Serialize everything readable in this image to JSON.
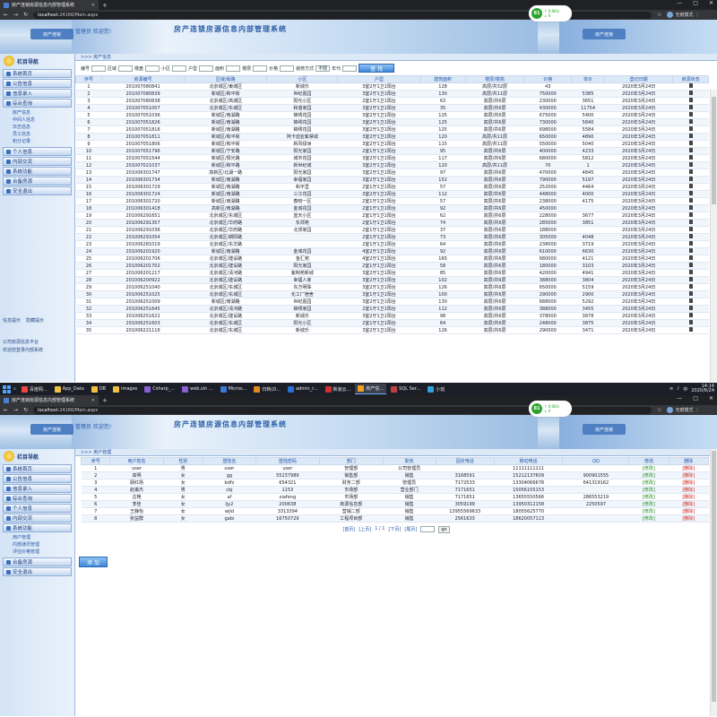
{
  "browser": {
    "tab_title": "房产连锁房源信息内部管理系统",
    "new_tab_symbol": "+",
    "url_host": "localhost",
    "url_path": ":24166/Main.aspx",
    "profile_name": "无痕模式",
    "win_min": "—",
    "win_max": "□",
    "win_close": "✕"
  },
  "netmon": {
    "percent": "81",
    "up": "↑ 0.6K/s",
    "down": "↓ 0"
  },
  "app": {
    "welcome": "管理员 欢迎您!",
    "title": "房产连锁房源信息内部管理系统",
    "logo_text": "房产连锁"
  },
  "sidebar": {
    "home_label": "栏目导航",
    "menus": [
      "系统首页",
      "公告信息",
      "信息录入",
      "综合查询",
      "个人信息",
      "内部交流",
      "系统功能",
      "合备房源",
      "安全退出"
    ],
    "sub_query": [
      "房产信息",
      "中间人信息",
      "日志信息",
      "员工信息",
      "积分记录"
    ],
    "sub_system": [
      "用户管理",
      "内部通讯管理",
      "评估价格管理"
    ],
    "footer_a": [
      "信息提示",
      "隐藏提示"
    ],
    "footer_b": [
      "公司房源信息平台",
      "欢迎您登录内部系统"
    ]
  },
  "screen_a": {
    "breadcrumb": ">>> 房产信息",
    "filters": [
      "编号",
      "区域",
      "楼盘",
      "小区",
      "户型",
      "面积",
      "楼层",
      "价格",
      "装修方式",
      "年代"
    ],
    "filter_select": "不限",
    "query_button": "查 找",
    "columns": [
      "序号",
      "房源编号",
      "区域/街路",
      "小区",
      "户型",
      "建筑面积",
      "楼层/楼高",
      "价格",
      "单价",
      "登记日期",
      "房源状态"
    ],
    "rows": [
      [
        "1",
        "201007080841",
        "北京城区/東城区",
        "新城乐",
        "3室2厅1卫1阳台",
        "128",
        "高层/共32层",
        "43",
        "",
        "2020年3月24日"
      ],
      [
        "2",
        "201007080839",
        "新城区/和平街",
        "世纪嘉园",
        "3室2厅1卫1阳台",
        "130",
        "高层/共11层",
        "750000",
        "5385",
        "2020年3月24日"
      ],
      [
        "3",
        "201007080838",
        "北京城区/高城区",
        "阳光小区",
        "2室1厅1卫1阳台",
        "63",
        "高层/共6层",
        "230000",
        "3651",
        "2020年3月24日"
      ],
      [
        "4",
        "201007051007",
        "北京城区/东城区",
        "和谐家园",
        "3室2厅1卫1阳台",
        "35",
        "高层/共6层",
        "430000",
        "11754",
        "2020年3月24日"
      ],
      [
        "5",
        "201007051036",
        "新城区/南湖路",
        "锦绣花园",
        "3室2厅1卫1阳台",
        "125",
        "高层/共6层",
        "675000",
        "5400",
        "2020年3月24日"
      ],
      [
        "6",
        "201007051826",
        "新城区/南湖路",
        "锦绣花园",
        "3室2厅1卫1阳台",
        "125",
        "高层/共6层",
        "730000",
        "5840",
        "2020年3月24日"
      ],
      [
        "7",
        "201007051816",
        "新城区/南湖路",
        "锦绣花园",
        "3室2厅1卫1阳台",
        "125",
        "高层/共6层",
        "698000",
        "5584",
        "2020年3月24日"
      ],
      [
        "8",
        "201007051811",
        "新城区/和平街",
        "阿卡迪亚紫禁城",
        "3室2厅1卫1阳台",
        "120",
        "高层/共11层",
        "650000",
        "4890",
        "2020年3月24日"
      ],
      [
        "9",
        "201007051806",
        "新城区/和平街",
        "新风绿洲",
        "3室2厅1卫1阳台",
        "115",
        "高层/共11层",
        "550000",
        "5040",
        "2020年3月24日"
      ],
      [
        "10",
        "201007051796",
        "新城区/宁安路",
        "阳光家园",
        "2室1厅1卫1阳台",
        "95",
        "高层/共6层",
        "400000",
        "4233",
        "2020年3月24日"
      ],
      [
        "11",
        "201007051544",
        "新城区/阳光路",
        "城市花园",
        "3室2厅1卫1阳台",
        "117",
        "高层/共6层",
        "680000",
        "5812",
        "2020年3月24日"
      ],
      [
        "12",
        "201007021037",
        "新城区/和平路",
        "新世纪城",
        "3室2厅1卫1阳台",
        "120",
        "高层/共11层",
        "70",
        "1",
        "2020年3月24日"
      ],
      [
        "13",
        "201006301747",
        "高新区/北湖一路",
        "阳光家园",
        "3室2厅1卫1阳台",
        "97",
        "高层/共6层",
        "470000",
        "4845",
        "2020年3月24日"
      ],
      [
        "14",
        "201006301734",
        "新城区/南湖路",
        "幸福家园",
        "3室2厅1卫1阳台",
        "152",
        "高层/共6层",
        "790000",
        "5197",
        "2020年3月24日"
      ],
      [
        "15",
        "201006301729",
        "新城区/南湖路",
        "和平里",
        "2室1厅1卫1阳台",
        "57",
        "高层/共6层",
        "252000",
        "4464",
        "2020年3月24日"
      ],
      [
        "16",
        "201006301724",
        "新城区/南湖路",
        "三江花园",
        "3室2厅1卫1阳台",
        "112",
        "高层/共6层",
        "448000",
        "4000",
        "2020年3月24日"
      ],
      [
        "17",
        "201006301720",
        "新城区/南湖路",
        "春晓一区",
        "2室1厅1卫1阳台",
        "57",
        "高层/共6层",
        "238000",
        "4175",
        "2020年3月24日"
      ],
      [
        "18",
        "201006301418",
        "高新区/南湖路",
        "金城花园",
        "2室1厅1卫1阳台",
        "92",
        "高层/共6层",
        "450000",
        "",
        "2020年3月24日"
      ],
      [
        "19",
        "201006291651",
        "北京城区/东城区",
        "蓝天小区",
        "2室1厅1卫1阳台",
        "62",
        "高层/共6层",
        "228000",
        "3677",
        "2020年3月24日"
      ],
      [
        "20",
        "201006291357",
        "北京城区/华府路",
        "东郊苑",
        "2室1厅1卫1阳台",
        "74",
        "高层/共6层",
        "285000",
        "3851",
        "2020年3月24日"
      ],
      [
        "21",
        "201006291036",
        "北京城区/华府路",
        "北郊家园",
        "2室1厅1卫1阳台",
        "37",
        "高层/共6层",
        "188000",
        "",
        "2020年3月24日"
      ],
      [
        "22",
        "201006291054",
        "北京城区/朝阳路",
        "",
        "2室1厅1卫1阳台",
        "73",
        "高层/共6层",
        "305000",
        "4048",
        "2020年3月24日"
      ],
      [
        "23",
        "201006281019",
        "北京城区/东华路",
        "",
        "2室1厅1卫1阳台",
        "64",
        "高层/共6层",
        "238000",
        "3719",
        "2020年3月24日"
      ],
      [
        "24",
        "201006201920",
        "新城区/南湖路",
        "金城花园",
        "4室2厅1卫1阳台",
        "92",
        "高层/共6层",
        "610000",
        "6630",
        "2020年3月24日"
      ],
      [
        "25",
        "201006201706",
        "北京城区/建设路",
        "金汇苑",
        "4室2厅1卫1阳台",
        "165",
        "高层/共6层",
        "680000",
        "4121",
        "2020年3月24日"
      ],
      [
        "26",
        "201006201702",
        "北京城区/建设路",
        "阳光家园",
        "2室1厅1卫1阳台",
        "58",
        "高层/共6层",
        "180000",
        "3103",
        "2020年3月24日"
      ],
      [
        "27",
        "201006201217",
        "北京城区/清河路",
        "紫荆苑新城",
        "3室2厅1卫1阳台",
        "85",
        "高层/共6层",
        "420000",
        "4941",
        "2020年3月24日"
      ],
      [
        "28",
        "201006200922",
        "北京城区/建设路",
        "幸福人家",
        "3室2厅1卫1阳台",
        "102",
        "高层/共6层",
        "388000",
        "3804",
        "2020年3月24日"
      ],
      [
        "29",
        "201006251040",
        "北京城区/东城区",
        "东方明珠",
        "3室2厅1卫1阳台",
        "126",
        "高层/共6层",
        "650000",
        "5159",
        "2020年3月24日"
      ],
      [
        "30",
        "201006251025",
        "北京城区/东城区",
        "化工厂宿舍",
        "3室1厅1卫1阳台",
        "100",
        "高层/共6层",
        "290000",
        "2900",
        "2020年3月24日"
      ],
      [
        "31",
        "201006251009",
        "新城区/南湖路",
        "世纪嘉园",
        "3室2厅1卫1阳台",
        "130",
        "高层/共6层",
        "688000",
        "5292",
        "2020年3月24日"
      ],
      [
        "32",
        "201006251645",
        "北京城区/清河路",
        "锦绣家园",
        "2室1厅1卫1阳台",
        "112",
        "高层/共6层",
        "388000",
        "3455",
        "2020年3月24日"
      ],
      [
        "33",
        "201006251622",
        "北京城区/建设路",
        "新城乐",
        "3室2厅1卫1阳台",
        "98",
        "高层/共6层",
        "378000",
        "3878",
        "2020年3月24日"
      ],
      [
        "34",
        "201006251603",
        "北京城区/东城区",
        "阳光小区",
        "2室1厅1卫1阳台",
        "64",
        "高层/共6层",
        "248000",
        "3875",
        "2020年3月24日"
      ],
      [
        "35",
        "201006221116",
        "北京城区/东城区",
        "新城乐",
        "3室2厅1卫1阳台",
        "126",
        "高层/共6层",
        "290000",
        "3471",
        "2020年3月24日"
      ]
    ]
  },
  "screen_b": {
    "breadcrumb": ">>> 用户管理",
    "columns": [
      "序号",
      "用户姓名",
      "性别",
      "登陆名",
      "登陆密码",
      "部门",
      "职务",
      "固定电话",
      "移动电话",
      "QQ",
      "修改",
      "删除"
    ],
    "rows": [
      [
        "1",
        "user",
        "男",
        "user",
        "user",
        "管理部",
        "公司管理员",
        "",
        "11111111111",
        "",
        "[修改]",
        "[删除]"
      ],
      [
        "2",
        "高明",
        "女",
        "gg",
        "55237989",
        "销售部",
        "销售",
        "3168591",
        "15212137609",
        "900901555",
        "[修改]",
        "[删除]"
      ],
      [
        "3",
        "顾红扬",
        "女",
        "bdfz",
        "654321",
        "财务二部",
        "管理员",
        "7172533",
        "13304066678",
        "641319162",
        "[修改]",
        "[删除]"
      ],
      [
        "4",
        "赵甫杰",
        "男",
        "cbj",
        "1153",
        "市场部",
        "营业部门",
        "7171651",
        "15056155153",
        "",
        "[修改]",
        "[删除]"
      ],
      [
        "5",
        "古艳",
        "女",
        "af",
        "xiafeng",
        "市场部",
        "销售",
        "7171651",
        "13655550566",
        "286553219",
        "[修改]",
        "[删除]"
      ],
      [
        "6",
        "李佳",
        "女",
        "ljy2",
        "200638",
        "房源信息部",
        "销售",
        "3059199",
        "13950312158",
        "2250597",
        "[修改]",
        "[删除]"
      ],
      [
        "7",
        "王静怡",
        "女",
        "wjid",
        "3313394",
        "营销二部",
        "销售",
        "13955569633",
        "18055625770",
        "",
        "[修改]",
        "[删除]"
      ],
      [
        "8",
        "张益群",
        "女",
        "gabi",
        "16750729",
        "工程项目部",
        "销售",
        "2561633",
        "18620057113",
        "",
        "[修改]",
        "[删除]"
      ]
    ],
    "pager": [
      "[首页]",
      "[上页]",
      "1 / 1",
      "[下页]",
      "[尾页]"
    ],
    "go_label": "go",
    "add_button": "添 加"
  },
  "taskbar": {
    "items": [
      "百度网...",
      "App_Data",
      "DB",
      "images",
      "Csharp_...",
      "web.sln ...",
      "Micros...",
      "归档(D...",
      "admin_r...",
      "新浪云...",
      "房产信...",
      "SQL Ser...",
      "小班"
    ],
    "time": "14:14",
    "date": "2020/6/24"
  },
  "colors": {
    "accent": "#2c5fa8",
    "edit": "#1a8a1a",
    "delete": "#d01818",
    "header_bg": "#dbe8f7"
  }
}
